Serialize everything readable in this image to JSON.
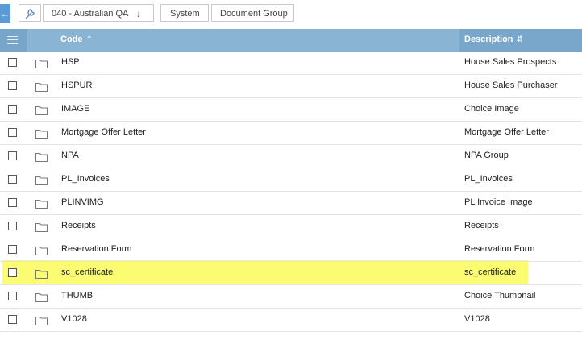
{
  "breadcrumb": {
    "company": "040 - Australian QA",
    "system": "System",
    "document_group": "Document Group"
  },
  "table": {
    "columns": {
      "code": "Code",
      "description": "Description"
    },
    "rows": [
      {
        "code": "HSP",
        "description": "House Sales Prospects"
      },
      {
        "code": "HSPUR",
        "description": "House Sales Purchaser"
      },
      {
        "code": "IMAGE",
        "description": "Choice Image"
      },
      {
        "code": "Mortgage Offer Letter",
        "description": "Mortgage Offer Letter"
      },
      {
        "code": "NPA",
        "description": "NPA Group"
      },
      {
        "code": "PL_Invoices",
        "description": "PL_Invoices"
      },
      {
        "code": "PLINVIMG",
        "description": "PL Invoice Image"
      },
      {
        "code": "Receipts",
        "description": "Receipts"
      },
      {
        "code": "Reservation Form",
        "description": "Reservation Form"
      },
      {
        "code": "sc_certificate",
        "description": "sc_certificate"
      },
      {
        "code": "THUMB",
        "description": "Choice Thumbnail"
      },
      {
        "code": "V1028",
        "description": "V1028"
      }
    ]
  },
  "colors": {
    "header": "#8ab4d4",
    "accent": "#5b9bd5",
    "highlight": "#fcfc72"
  }
}
